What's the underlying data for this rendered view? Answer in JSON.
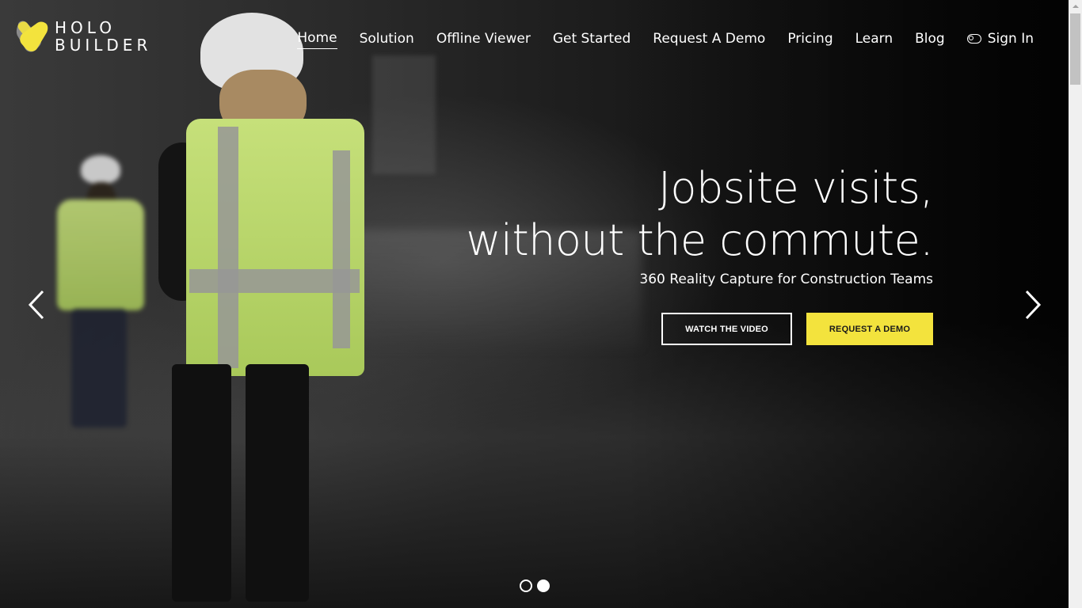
{
  "brand": {
    "line1": "HOLO",
    "line2": "BUILDER",
    "accent_color": "#f3e33d"
  },
  "nav": {
    "items": [
      {
        "label": "Home",
        "active": true
      },
      {
        "label": "Solution"
      },
      {
        "label": "Offline Viewer"
      },
      {
        "label": "Get Started"
      },
      {
        "label": "Request A Demo"
      },
      {
        "label": "Pricing"
      },
      {
        "label": "Learn"
      },
      {
        "label": "Blog"
      }
    ],
    "signin": {
      "label": "Sign In",
      "icon": "toggle-icon"
    }
  },
  "hero": {
    "headline_line1": "Jobsite visits,",
    "headline_line2": "without the commute.",
    "subheadline": "360 Reality Capture for Construction Teams",
    "buttons": {
      "watch_video": "WATCH THE VIDEO",
      "request_demo": "REQUEST A DEMO"
    }
  },
  "carousel": {
    "prev_icon": "chevron-left-icon",
    "next_icon": "chevron-right-icon",
    "slide_count": 2,
    "active_slide": 2
  }
}
